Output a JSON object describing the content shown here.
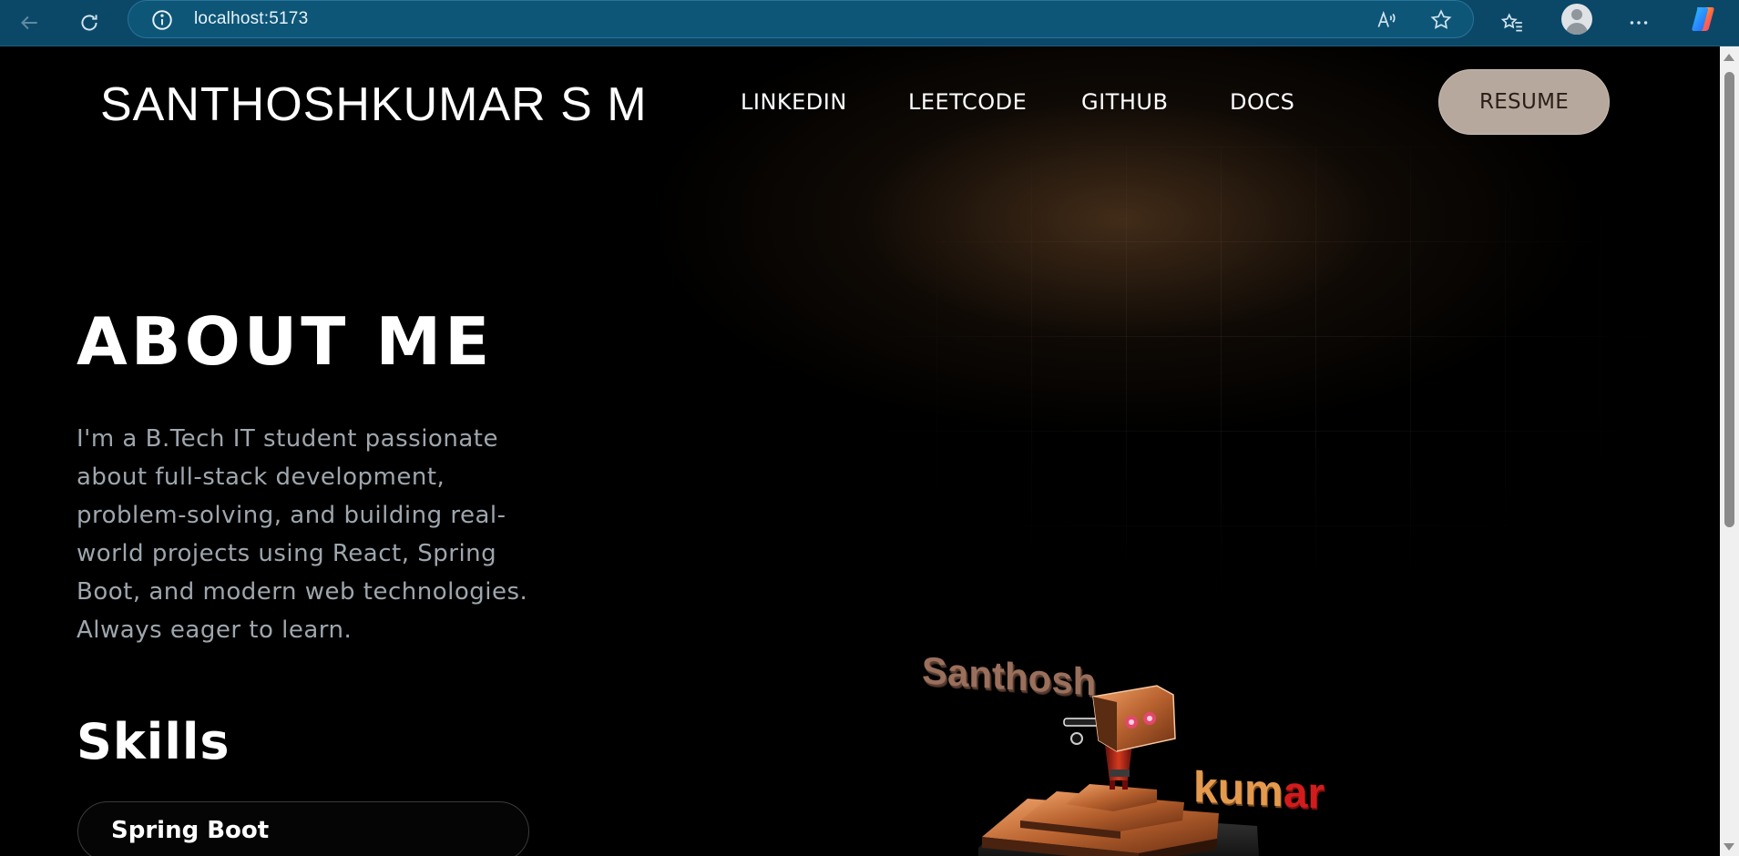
{
  "browser": {
    "url": "localhost:5173"
  },
  "header": {
    "brand": "SANTHOSHKUMAR S M",
    "nav": [
      {
        "label": "LINKEDIN"
      },
      {
        "label": "LEETCODE"
      },
      {
        "label": "GITHUB"
      },
      {
        "label": "DOCS"
      }
    ],
    "resume_label": "RESUME"
  },
  "about": {
    "title": "ABOUT ME",
    "lines": [
      "I'm a B.Tech IT student passionate",
      "about full-stack development,",
      "problem-solving, and building real-",
      "world projects using React, Spring",
      "Boot, and modern web technologies.",
      "Always eager to learn."
    ]
  },
  "skills": {
    "title": "Skills",
    "items": [
      "Spring Boot"
    ]
  },
  "scene": {
    "word1": "Santhosh",
    "word2_a": "kum",
    "word2_b": "ar"
  },
  "colors": {
    "browser_bar": "#0b4868",
    "resume_bg": "#b7a89d",
    "body_text": "#9ea6ad",
    "accent_orange": "#e49a4e",
    "accent_red": "#d21c1c"
  }
}
